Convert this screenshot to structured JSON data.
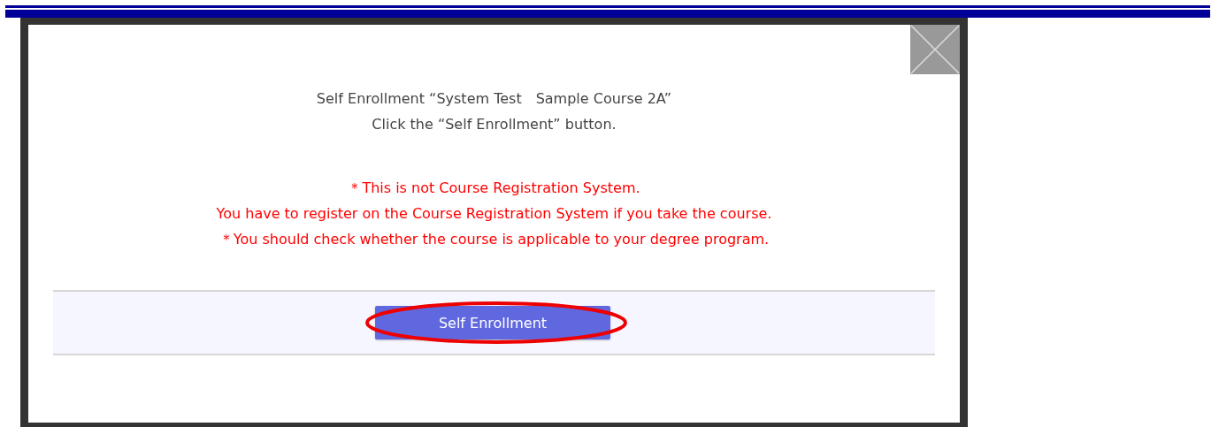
{
  "dialog": {
    "message": [
      "Self Enrollment “System Test　Sample Course 2A”",
      "Click the “Self Enrollment” button."
    ],
    "notices": [
      "＊This is not Course Registration System.",
      "You have to register on the Course Registration System if you take the course.",
      "＊You should check whether the course is applicable to your degree program."
    ],
    "button": {
      "label": "Self Enrollment",
      "highlighted": true
    }
  }
}
